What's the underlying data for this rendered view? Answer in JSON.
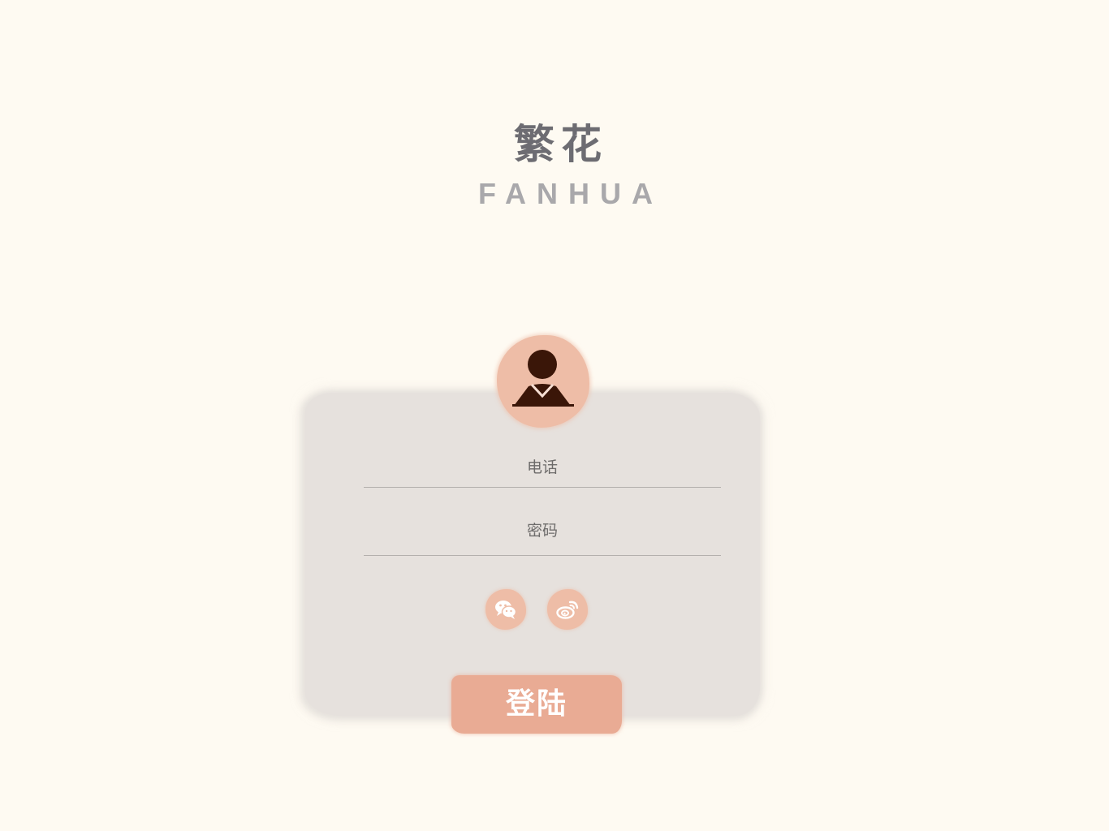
{
  "brand": {
    "name_cn": "繁花",
    "name_en": "FANHUA"
  },
  "login_form": {
    "avatar_icon": "user-avatar-icon",
    "phone_placeholder": "电话",
    "password_placeholder": "密码",
    "social": [
      {
        "icon": "wechat-icon"
      },
      {
        "icon": "weibo-icon"
      }
    ],
    "submit_label": "登陆"
  },
  "colors": {
    "background": "#fefaf2",
    "card": "#e6e1dd",
    "accent": "#e9ab94",
    "accent_light": "#eebda7",
    "title": "#6d6c72",
    "subtitle": "#a9a8ab",
    "icon_dark": "#3a1608"
  }
}
